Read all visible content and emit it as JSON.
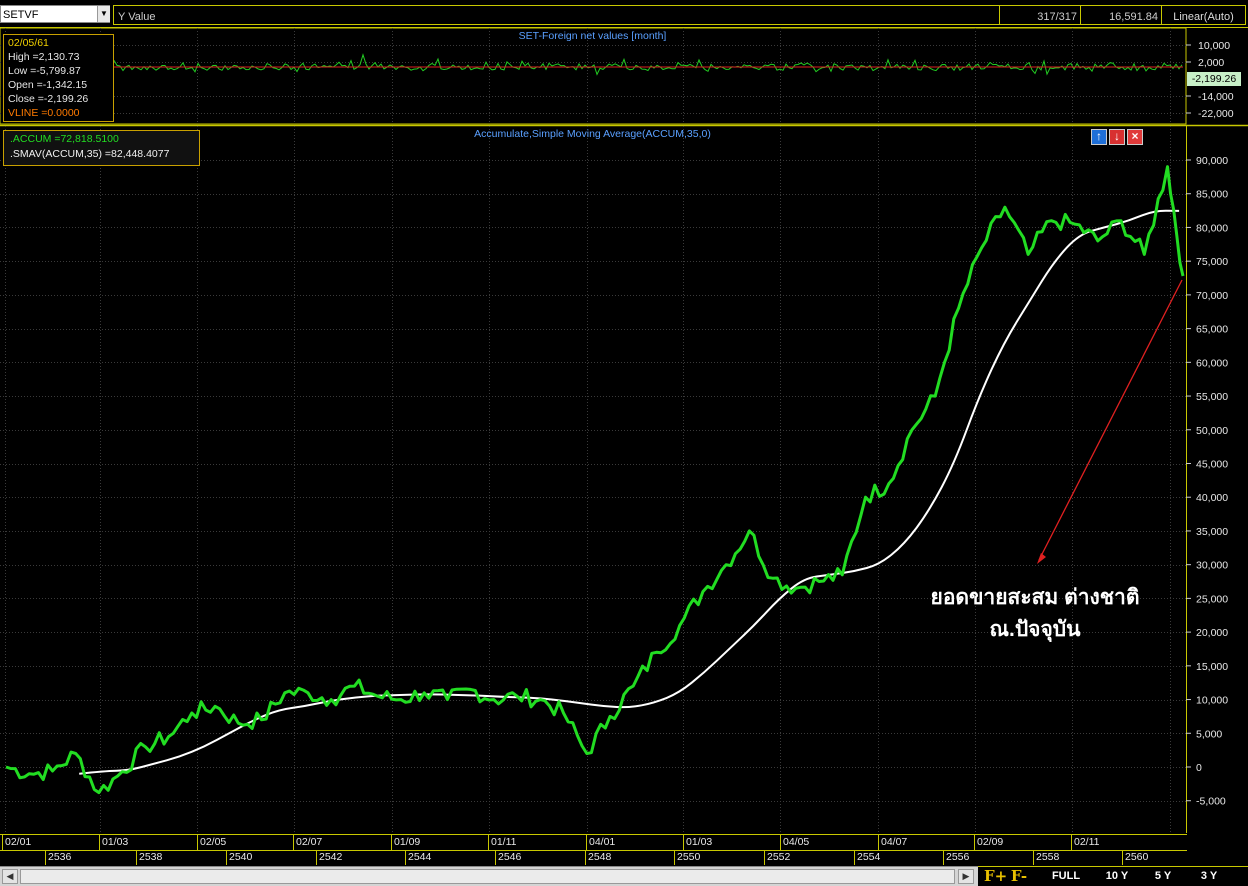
{
  "toolbar": {
    "symbol": "SETVF",
    "y_value_label": "Y Value",
    "count": "317/317",
    "price": "16,591.84",
    "scale_mode": "Linear(Auto)"
  },
  "upper_panel": {
    "title": "SET-Foreign net values [month]",
    "ticks": [
      "10,000",
      "2,000",
      "-6,000",
      "-14,000",
      "-22,000"
    ],
    "last_value": "-2,199.26",
    "info": {
      "date": "02/05/61",
      "high": "High  =2,130.73",
      "low": "Low  =-5,799.87",
      "open": "Open  =-1,342.15",
      "close": "Close  =-2,199.26",
      "vline": "VLINE  =0.0000"
    }
  },
  "main_panel": {
    "title": "Accumulate,Simple Moving Average(ACCUM,35,0)",
    "info": {
      "accum": ".ACCUM    =72,818.5100",
      "smav": ".SMAV(ACCUM,35)    =82,448.4077"
    },
    "annotation_line1": "ยอดขายสะสม ต่างชาติ",
    "annotation_line2": "ณ.ปัจจุบัน"
  },
  "colors": {
    "accum": "#22dd22",
    "smav": "#ffffff",
    "frame": "#c8c800",
    "grid": "#3a3a3a",
    "title": "#5aa0ff",
    "arrow": "#e02020"
  },
  "xaxis": {
    "months": [
      "02/01",
      "01/03",
      "02/05",
      "02/07",
      "01/09",
      "01/11",
      "04/01",
      "01/03",
      "04/05",
      "04/07",
      "02/09",
      "02/11"
    ],
    "years": [
      "2536",
      "2538",
      "2540",
      "2542",
      "2544",
      "2546",
      "2548",
      "2550",
      "2552",
      "2554",
      "2556",
      "2558",
      "2560"
    ]
  },
  "zoom_buttons": [
    "F+",
    "F-",
    "FULL",
    "10 Y",
    "5 Y",
    "3 Y"
  ],
  "chart_data": {
    "type": "line",
    "ylim": [
      -7500,
      92000
    ],
    "yticks": [
      "90,000",
      "85,000",
      "80,000",
      "75,000",
      "70,000",
      "65,000",
      "60,000",
      "55,000",
      "50,000",
      "45,000",
      "40,000",
      "35,000",
      "30,000",
      "25,000",
      "20,000",
      "15,000",
      "10,000",
      "5,000",
      "0",
      "-5,000"
    ],
    "ytick_values": [
      90000,
      85000,
      80000,
      75000,
      70000,
      65000,
      60000,
      55000,
      50000,
      45000,
      40000,
      35000,
      30000,
      25000,
      20000,
      15000,
      10000,
      5000,
      0,
      -5000
    ],
    "x": [
      "1993-01",
      "1993-07",
      "1994-01",
      "1994-07",
      "1995-01",
      "1995-07",
      "1996-01",
      "1996-07",
      "1997-01",
      "1997-07",
      "1998-01",
      "1998-07",
      "1999-01",
      "1999-07",
      "2000-01",
      "2000-07",
      "2001-01",
      "2001-07",
      "2002-01",
      "2002-07",
      "2003-01",
      "2003-07",
      "2004-01",
      "2004-07",
      "2005-01",
      "2005-07",
      "2006-01",
      "2006-07",
      "2007-01",
      "2007-07",
      "2008-01",
      "2008-07",
      "2009-01",
      "2009-07",
      "2010-01",
      "2010-07",
      "2011-01",
      "2011-07",
      "2012-01",
      "2012-07",
      "2013-01",
      "2013-07",
      "2014-01",
      "2014-07",
      "2015-01",
      "2015-07",
      "2016-01",
      "2016-07",
      "2017-01",
      "2017-07",
      "2018-01",
      "2018-05"
    ],
    "series": [
      {
        "name": ".ACCUM",
        "values": [
          0,
          -1000,
          -600,
          2000,
          -3800,
          -700,
          3000,
          4500,
          8000,
          9000,
          6500,
          7000,
          11000,
          11000,
          10000,
          12000,
          10500,
          10000,
          11000,
          10000,
          11500,
          10000,
          10500,
          10000,
          8000,
          2000,
          7500,
          12000,
          17000,
          21000,
          26000,
          30000,
          35000,
          28000,
          26500,
          27500,
          28500,
          40000,
          42000,
          50000,
          55000,
          68000,
          77000,
          83000,
          76000,
          81000,
          80500,
          78000,
          81000,
          76000,
          89000,
          72800
        ]
      },
      {
        "name": ".SMAV(ACCUM,35)",
        "values": [
          null,
          null,
          -1000,
          -600,
          -500,
          500,
          1500,
          3000,
          5000,
          7000,
          8500,
          9000,
          9800,
          10300,
          10600,
          10700,
          10800,
          10700,
          10600,
          10400,
          10300,
          10000,
          9500,
          9000,
          8800,
          9500,
          11000,
          14000,
          17500,
          21000,
          25000,
          28000,
          28500,
          29000,
          30000,
          33000,
          38000,
          45000,
          55000,
          63000,
          69000,
          75000,
          79000,
          80000,
          81000,
          82500,
          82448
        ]
      }
    ]
  }
}
